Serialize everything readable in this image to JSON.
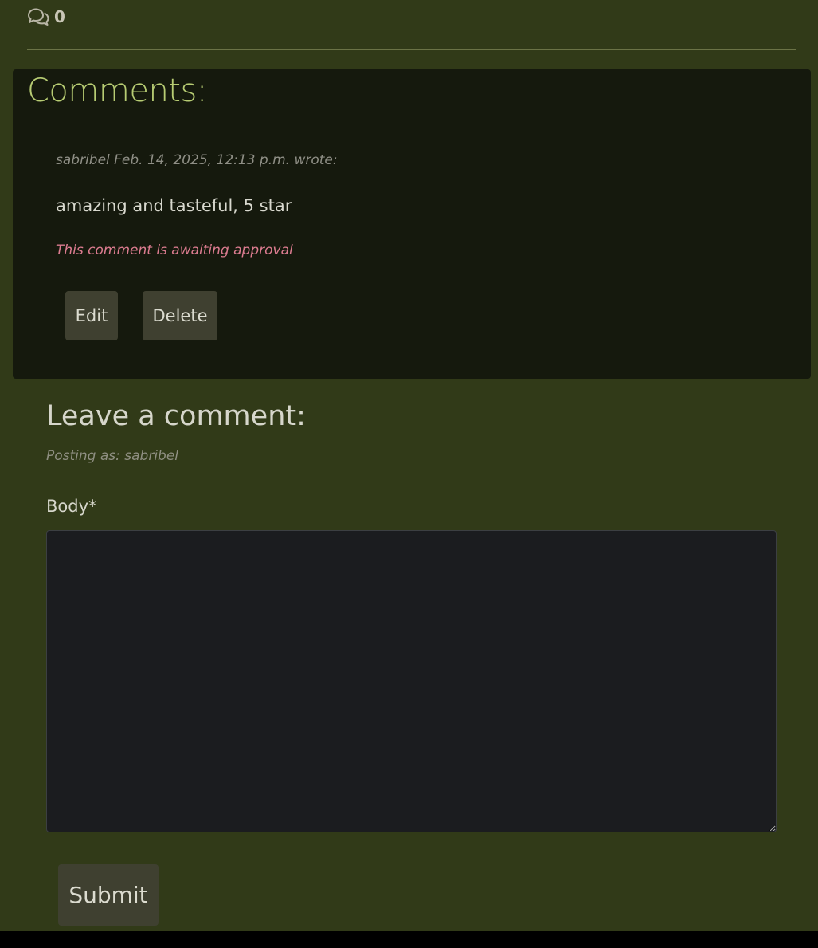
{
  "stats": {
    "comment_icon": "comments-icon",
    "comment_count": "0"
  },
  "comments": {
    "title": "Comments:",
    "items": [
      {
        "meta": "sabribel Feb. 14, 2025, 12:13 p.m. wrote:",
        "body": "amazing and tasteful, 5 star",
        "status": "This comment is awaiting approval",
        "edit_label": "Edit",
        "delete_label": "Delete"
      }
    ]
  },
  "comment_form": {
    "title": "Leave a comment:",
    "posting_as": "Posting as: sabribel",
    "body_label": "Body*",
    "body_value": "",
    "submit_label": "Submit"
  },
  "colors": {
    "page_background": "#313a18",
    "card_background": "#15190d",
    "heading_accent": "#b7cc73",
    "awaiting_status": "#dc7c90",
    "button_background": "#3f4030",
    "textarea_background": "#1b1c1f"
  }
}
